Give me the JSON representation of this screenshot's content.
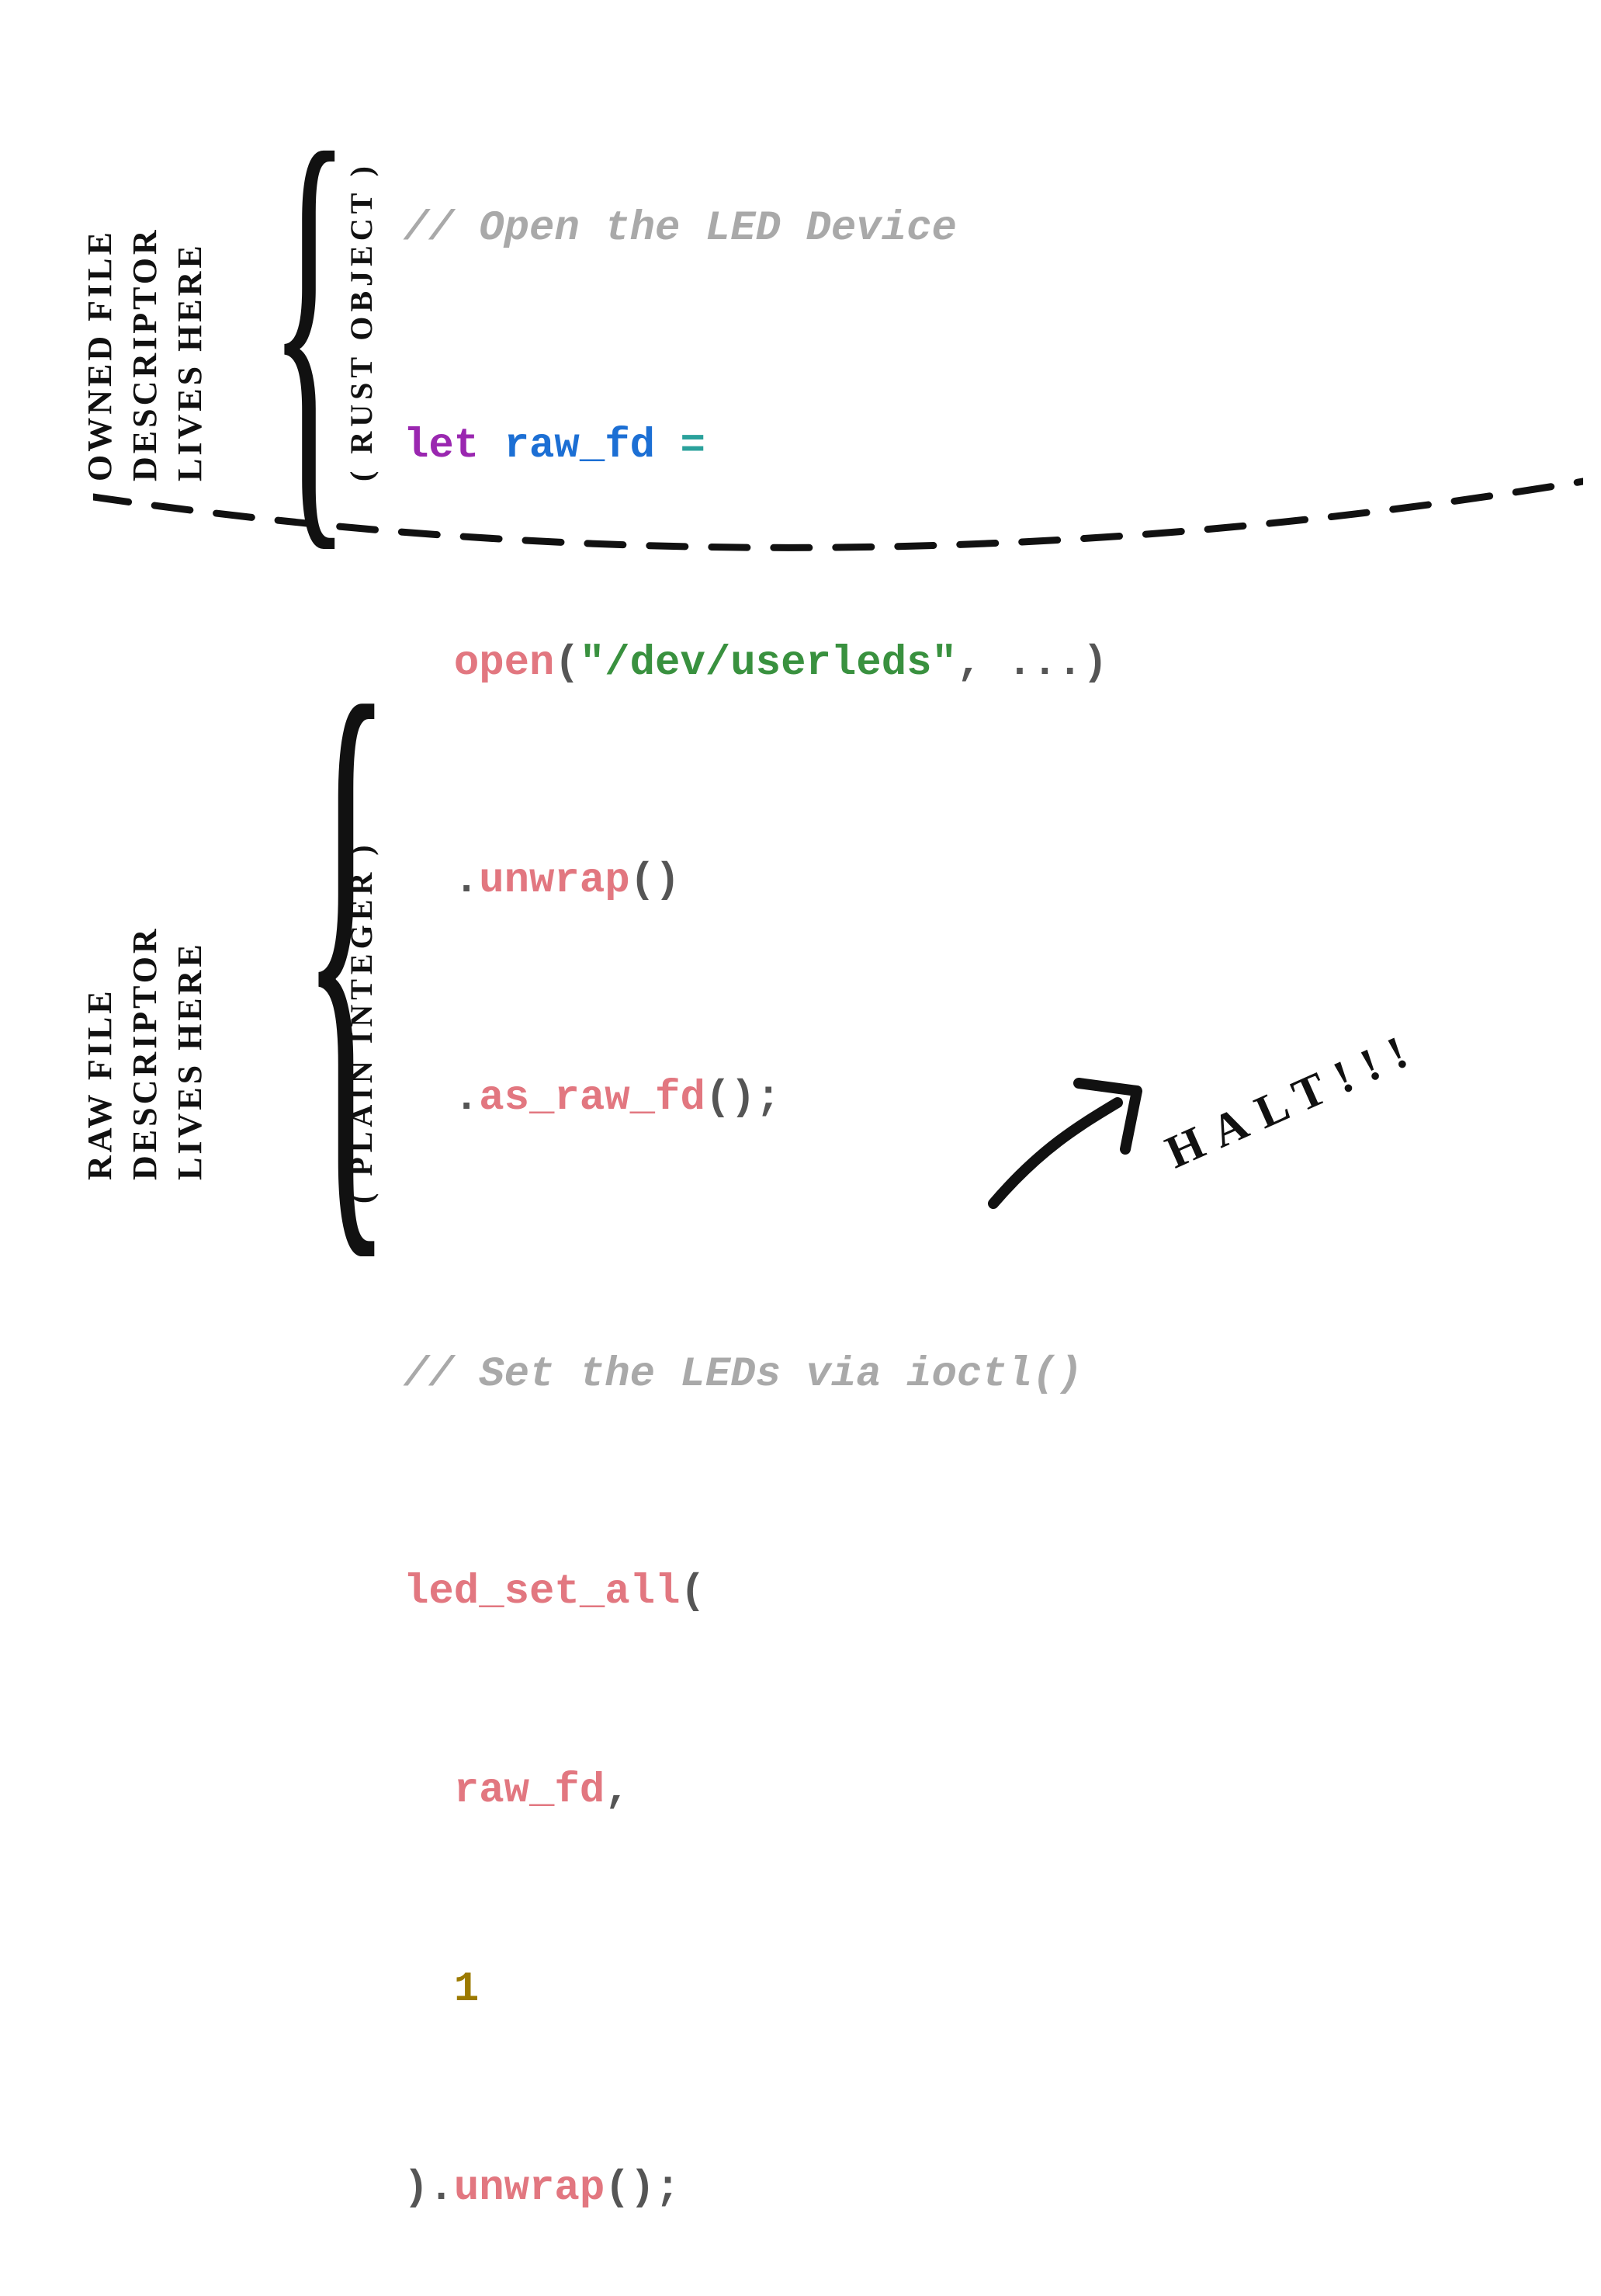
{
  "labels": {
    "top": {
      "l1": "OWNED FILE",
      "l2": "DESCRIPTOR",
      "l3": "LIVES HERE"
    },
    "top_sub": "( RUST OBJECT )",
    "bottom": {
      "l1": "RAW FILE",
      "l2": "DESCRIPTOR",
      "l3": "LIVES HERE"
    },
    "bottom_sub": "( PLAIN INTEGER )"
  },
  "halt": "HALT!!!",
  "code": {
    "comment1": "// Open the LED Device",
    "let": "let",
    "var": "raw_fd",
    "eq": "=",
    "open_fn": "open",
    "open_paren_l": "(",
    "path_str": "\"/dev/userleds\"",
    "comma1": ",",
    "dots": "...",
    "open_paren_r": ")",
    "dot1": ".",
    "unwrap1": "unwrap",
    "paren_empty1": "()",
    "dot2": ".",
    "as_raw_fd": "as_raw_fd",
    "paren_empty2": "()",
    "semi1": ";",
    "comment2": "// Set the LEDs via ioctl()",
    "led_fn": "led_set_all",
    "led_paren_l": "(",
    "arg_var": "raw_fd",
    "comma2": ",",
    "num1": "1",
    "led_paren_r": ")",
    "dot3": ".",
    "unwrap2": "unwrap",
    "paren_empty3": "()",
    "semi2": ";"
  }
}
